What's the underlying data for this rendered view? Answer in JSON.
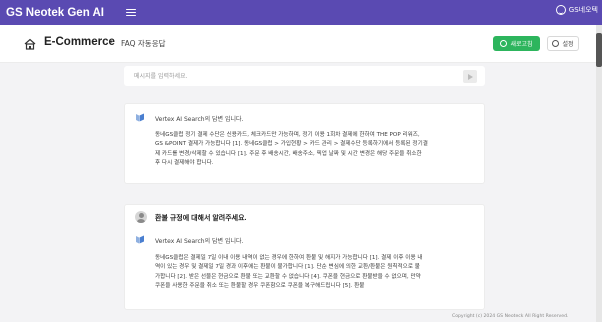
{
  "topbar": {
    "brand": "GS Neotek Gen AI",
    "user_label": "GS네오텍"
  },
  "header": {
    "breadcrumb_root": "E-Commerce",
    "breadcrumb_separator": "›",
    "breadcrumb_page": "FAQ 자동응답",
    "new_chat_label": "새로고침",
    "settings_label": "설정"
  },
  "input": {
    "placeholder": "메시지를 입력하세요."
  },
  "answers": [
    {
      "source_label": "Vertex AI Search의 답변 입니다.",
      "lines": [
        "동네GS클럽 정기 결제 수단은 신용카드, 체크카드만 가능하며, 정기 이용 1회차 결제에 한하여 THE POP 리워즈,",
        "GS &POINT 결제가 가능합니다 [1]. 동네GS클럽 > 가입현황 > 카드 관리 > 결제수단 등록하기에서 등록된 정기결",
        "제 카드를 변경/삭제할 수 있습니다 [1]. 주문 후 배송시간, 배송주소, 픽업 날짜 및 시간 변경은 해당 주문을 취소한",
        "후 다시 결제해야 합니다."
      ]
    },
    {
      "question": "환불 규정에 대해서 알려주세요.",
      "source_label": "Vertex AI Search의 답변 입니다.",
      "lines": [
        "동네GS클럽은 결제일 7일 이내 이용 내역이 없는 경우에 한하여 환불 및 해지가 가능합니다 [1]. 결제 이후 이용 내",
        "역이 있는 경우 및 결제일 7일 경과 이후에는 환불이 불가합니다 [1]. 단순 변심에 의한 교환/환불은 원칙적으로 불",
        "가합니다 [2]. 받은 선물은 현금으로 환불 또는 교환할 수 없습니다 [4]. 쿠폰을 현금으로 환불받을 수 없으며, 만약",
        "쿠폰을 사용한 주문을 취소 또는 환불할 경우 쿠폰함으로 쿠폰을 복구해드립니다 [5]. 환불"
      ]
    }
  ],
  "footer": {
    "copyright": "Copyright (c) 2024 GS Neoteck All Right Reserved."
  },
  "colors": {
    "topbar": "#5a4ab2",
    "accent_green": "#2db55d",
    "background": "#f3f3f5"
  },
  "icons": [
    "menu-icon",
    "user-icon",
    "home-icon",
    "refresh-icon",
    "gear-icon",
    "send-icon",
    "ai-response-icon",
    "user-avatar-icon"
  ]
}
